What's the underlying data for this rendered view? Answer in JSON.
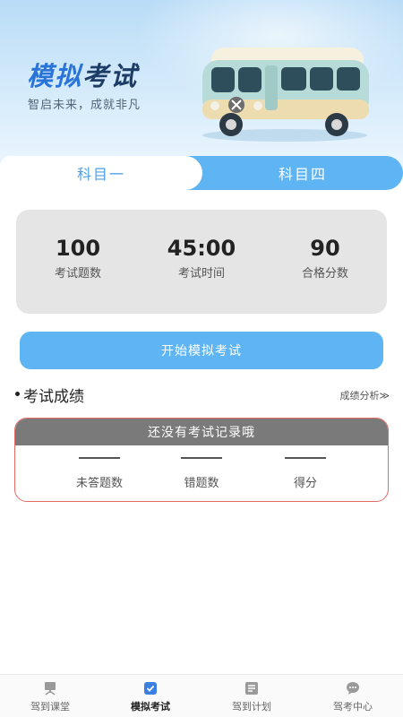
{
  "hero": {
    "title_part1": "模拟",
    "title_part2": "考试",
    "subtitle": "智启未来，成就非凡"
  },
  "subjects": {
    "active": "科目一",
    "inactive": "科目四"
  },
  "stats": [
    {
      "value": "100",
      "label": "考试题数"
    },
    {
      "value": "45:00",
      "label": "考试时间"
    },
    {
      "value": "90",
      "label": "合格分数"
    }
  ],
  "start_button": "开始模拟考试",
  "results": {
    "title": "考试成绩",
    "link": "成绩分析≫",
    "empty_message": "还没有考试记录哦",
    "columns": [
      "未答题数",
      "错题数",
      "得分"
    ]
  },
  "tabbar": [
    {
      "label": "驾到课堂",
      "icon": "classroom-icon"
    },
    {
      "label": "模拟考试",
      "icon": "exam-check-icon"
    },
    {
      "label": "驾到计划",
      "icon": "plan-list-icon"
    },
    {
      "label": "驾考中心",
      "icon": "chat-bubble-icon"
    }
  ],
  "colors": {
    "accent": "#5fb5f3",
    "active_tab_icon": "#3b7fe0",
    "record_border": "#e46b63",
    "record_header": "#7a7a7a",
    "stats_bg": "#e5e5e5"
  }
}
